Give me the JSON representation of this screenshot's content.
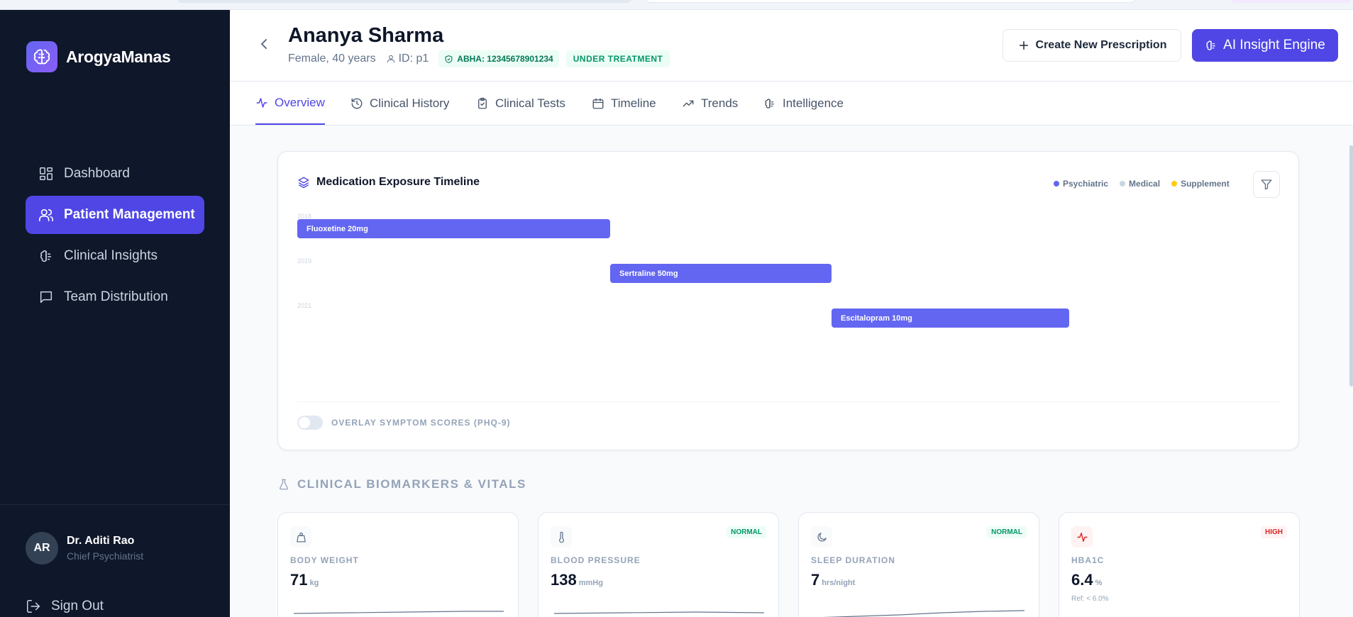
{
  "app": {
    "name": "ArogyaManas"
  },
  "sidebar": {
    "items": [
      {
        "label": "Dashboard",
        "icon": "dashboard-icon"
      },
      {
        "label": "Patient Management",
        "icon": "users-icon",
        "active": true
      },
      {
        "label": "Clinical Insights",
        "icon": "brain-icon"
      },
      {
        "label": "Team Distribution",
        "icon": "message-icon"
      }
    ],
    "user": {
      "initials": "AR",
      "name": "Dr. Aditi Rao",
      "role": "Chief Psychiatrist"
    },
    "signout_label": "Sign Out"
  },
  "header": {
    "patient_name": "Ananya Sharma",
    "demographics": "Female, 40 years",
    "patient_id": "ID: p1",
    "abha": "ABHA: 12345678901234",
    "status": "UNDER TREATMENT",
    "create_button": "Create New Prescription",
    "ai_button": "AI Insight Engine"
  },
  "tabs": [
    {
      "label": "Overview",
      "active": true
    },
    {
      "label": "Clinical History"
    },
    {
      "label": "Clinical Tests"
    },
    {
      "label": "Timeline"
    },
    {
      "label": "Trends"
    },
    {
      "label": "Intelligence"
    }
  ],
  "medication_timeline": {
    "title": "Medication Exposure Timeline",
    "legend": [
      {
        "label": "Psychiatric",
        "color": "#6366f1"
      },
      {
        "label": "Medical",
        "color": "#cbd5e1"
      },
      {
        "label": "Supplement",
        "color": "#facc15"
      }
    ],
    "year_labels": [
      "2018",
      "2019",
      "2021"
    ],
    "bars": [
      {
        "label": "Fluoxetine 20mg",
        "category": "Psychiatric"
      },
      {
        "label": "Sertraline 50mg",
        "category": "Psychiatric"
      },
      {
        "label": "Escitalopram 10mg",
        "category": "Psychiatric"
      }
    ],
    "overlay_toggle_label": "OVERLAY SYMPTOM SCORES (PHQ-9)",
    "overlay_enabled": false
  },
  "biomarkers": {
    "section_title": "CLINICAL BIOMARKERS & VITALS",
    "cards": [
      {
        "label": "BODY WEIGHT",
        "value": "71",
        "unit": "kg",
        "badge": "",
        "ref": "",
        "icon": "weight-icon"
      },
      {
        "label": "BLOOD PRESSURE",
        "value": "138",
        "unit": "mmHg",
        "badge": "NORMAL",
        "ref": "",
        "icon": "thermometer-icon"
      },
      {
        "label": "SLEEP DURATION",
        "value": "7",
        "unit": "hrs/night",
        "badge": "NORMAL",
        "ref": "",
        "icon": "moon-icon"
      },
      {
        "label": "HBA1C",
        "value": "6.4",
        "unit": "%",
        "badge": "HIGH",
        "ref": "Ref: < 6.0%",
        "icon": "activity-icon"
      }
    ]
  },
  "colors": {
    "accent": "#4f46e5",
    "sidebar_bg": "#0f172a",
    "bar": "#6366f1",
    "high": "#dc2626",
    "normal": "#059669"
  }
}
